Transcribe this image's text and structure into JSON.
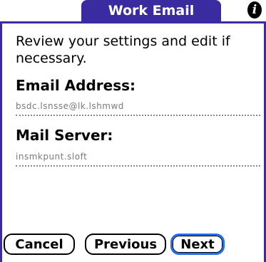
{
  "header": {
    "title": "Work Email",
    "info_glyph": "i"
  },
  "form": {
    "intro": "Review your settings and edit if necessary.",
    "email_label": "Email Address:",
    "email_value": "bsdc.lsnsse@lk.lshmwd",
    "server_label": "Mail Server:",
    "server_value": "insmkpunt.sloft"
  },
  "buttons": {
    "cancel": "Cancel",
    "previous": "Previous",
    "next": "Next"
  },
  "colors": {
    "title_bg": "#3b2ba0",
    "focus_ring": "#1f6ff0"
  },
  "icons": {
    "info": "info-icon"
  }
}
